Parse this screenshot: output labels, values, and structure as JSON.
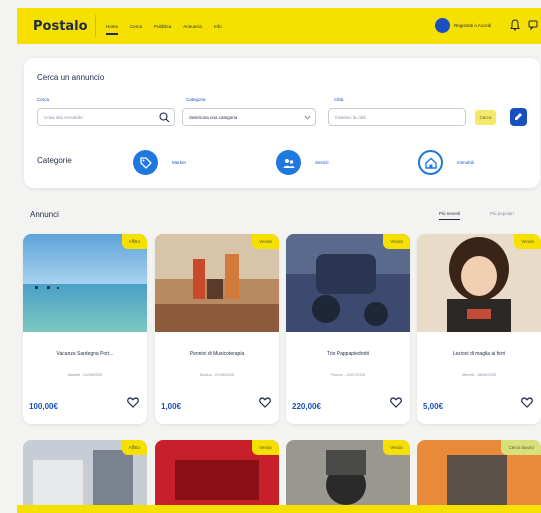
{
  "header": {
    "logo": "Postalo",
    "nav": [
      "Home",
      "Cerca",
      "Pubblica",
      "Annuncio",
      "Info"
    ],
    "login_label": "Registrati o Accedi"
  },
  "search": {
    "title": "Cerca un annuncio",
    "fields": [
      {
        "label": "Cerca",
        "placeholder": "Cosa stai cercando"
      },
      {
        "label": "Categoria",
        "placeholder": "Seleziona una categoria"
      },
      {
        "label": "Città",
        "placeholder": "Inserisci la città"
      }
    ],
    "search_button": "Cerca"
  },
  "categories": {
    "title": "Categorie",
    "items": [
      {
        "label": "Market",
        "icon": "tag-icon"
      },
      {
        "label": "Servizi",
        "icon": "people-icon"
      },
      {
        "label": "Immobili",
        "icon": "home-icon"
      }
    ]
  },
  "listings": {
    "title": "Annunci",
    "sort": [
      "Più recenti",
      "Più popolari"
    ],
    "items": [
      {
        "badge": "Affitto",
        "title": "Vacanze Sardegna Port...",
        "meta": "Mariotti - 02/08/2025",
        "price": "100,00€"
      },
      {
        "badge": "Vendo",
        "title": "Pennini di Musicoterapia",
        "meta": "Bovina - 07/08/2025",
        "price": "1,00€"
      },
      {
        "badge": "Vendo",
        "title": "Trio Pappapiedrotti",
        "meta": "Fiorino - 11/07/2025",
        "price": "220,00€"
      },
      {
        "badge": "Vendo",
        "title": "Lezioni di maglia ai ferri",
        "meta": "Moretti - 18/08/2025",
        "price": "5,00€"
      }
    ],
    "row2_badges": [
      "Affitto",
      "Vendo",
      "Vendo",
      "Cerca lavoro"
    ]
  },
  "colors": {
    "accent_yellow": "#f5e000",
    "brand_blue": "#1a4fbf"
  }
}
